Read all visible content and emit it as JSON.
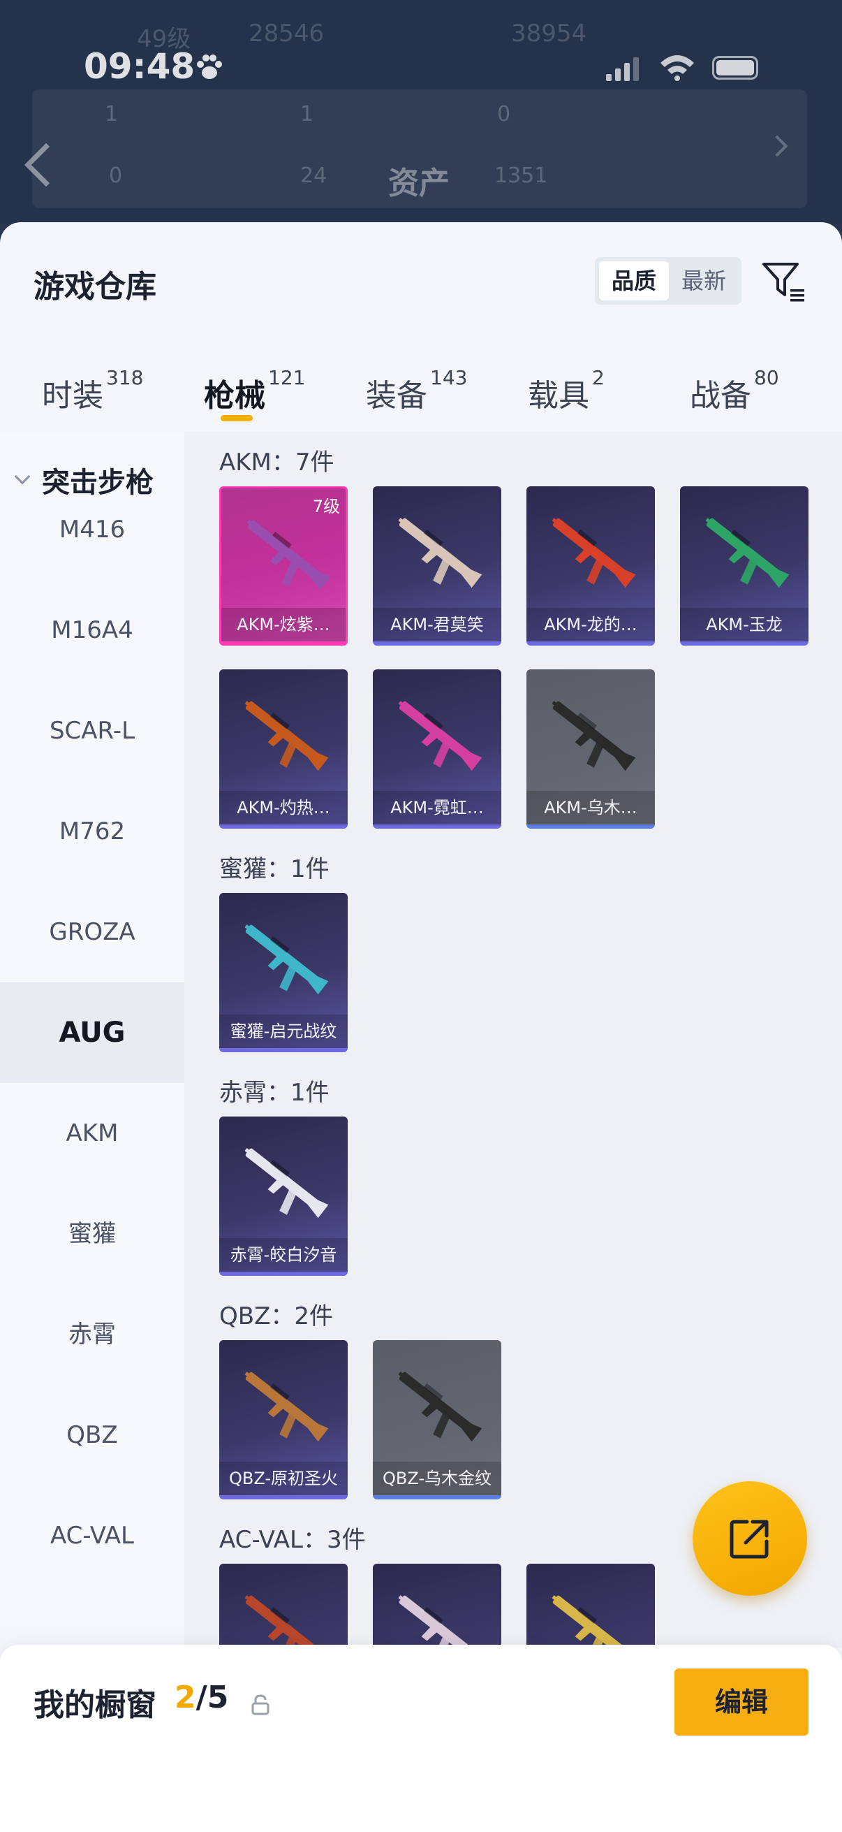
{
  "status": {
    "time": "09:48"
  },
  "background": {
    "title": "资产",
    "level": "49级",
    "stat_a": "28546",
    "stat_b": "38954",
    "row1": [
      "1",
      "1",
      "0"
    ],
    "row2": [
      "0",
      "24",
      "1351"
    ]
  },
  "sheet": {
    "title": "游戏仓库",
    "sort_options": [
      "品质",
      "最新"
    ],
    "tabs": [
      {
        "label": "时装",
        "count": "318"
      },
      {
        "label": "枪械",
        "count": "121"
      },
      {
        "label": "装备",
        "count": "143"
      },
      {
        "label": "载具",
        "count": "2"
      },
      {
        "label": "战备",
        "count": "80"
      }
    ]
  },
  "categories": {
    "group": "突击步枪",
    "items": [
      "M416",
      "M16A4",
      "SCAR-L",
      "M762",
      "GROZA",
      "AUG",
      "AKM",
      "蜜獾",
      "赤霄",
      "QBZ",
      "AC-VAL"
    ],
    "selected": "AUG"
  },
  "sections": [
    {
      "title": "AKM：7件",
      "items": [
        {
          "name": "AKM-炫紫…",
          "level": "7级",
          "style": "pink",
          "gun_color": "#9a4fb0"
        },
        {
          "name": "AKM-君莫笑",
          "style": "purple",
          "gun_color": "#d9c6b8"
        },
        {
          "name": "AKM-龙的…",
          "style": "purple",
          "gun_color": "#d8402a"
        },
        {
          "name": "AKM-玉龙",
          "style": "purple",
          "gun_color": "#2ea566"
        },
        {
          "name": "AKM-灼热…",
          "style": "purple",
          "gun_color": "#c65a1e"
        },
        {
          "name": "AKM-霓虹…",
          "style": "purple",
          "gun_color": "#d43fa0"
        },
        {
          "name": "AKM-乌木…",
          "style": "grey",
          "gun_color": "#2a2a2a"
        }
      ]
    },
    {
      "title": "蜜獾：1件",
      "items": [
        {
          "name": "蜜獾-启元战纹",
          "style": "purple",
          "gun_color": "#3fb6c9"
        }
      ]
    },
    {
      "title": "赤霄：1件",
      "items": [
        {
          "name": "赤霄-皎白汐音",
          "style": "purple",
          "gun_color": "#e6e6ee"
        }
      ]
    },
    {
      "title": "QBZ：2件",
      "items": [
        {
          "name": "QBZ-原初圣火",
          "style": "purple",
          "gun_color": "#b8763a"
        },
        {
          "name": "QBZ-乌木金纹",
          "style": "grey",
          "gun_color": "#2b2b2b"
        }
      ]
    },
    {
      "title": "AC-VAL：3件",
      "items": [
        {
          "name": "",
          "style": "purple",
          "gun_color": "#b8462a"
        },
        {
          "name": "",
          "style": "purple",
          "gun_color": "#d8c8d8"
        },
        {
          "name": "",
          "style": "purple",
          "gun_color": "#d8b64a"
        }
      ]
    }
  ],
  "showcase": {
    "label": "我的橱窗",
    "current": "2",
    "total": "/5",
    "edit_label": "编辑"
  }
}
